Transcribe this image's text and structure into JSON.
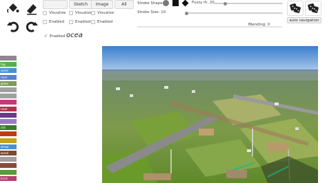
{
  "toolbar": {
    "tabs": [
      {
        "label": "",
        "dim": true
      },
      {
        "label": "Sketch",
        "dim": false
      },
      {
        "label": "Image",
        "dim": false
      },
      {
        "label": "All",
        "dim": false
      }
    ],
    "checkboxes": [
      {
        "label": "Visualize",
        "checked": false
      },
      {
        "label": "Visualize",
        "checked": false
      },
      {
        "label": "Visualize",
        "checked": false
      },
      {
        "label": "Enabled",
        "checked": false
      },
      {
        "label": "Enabled",
        "checked": false
      },
      {
        "label": "Enabled",
        "checked": false
      }
    ],
    "stroke_shape_label": "Stroke Shape",
    "stroke_size_label": "Stroke Size: 10",
    "fuzzy_label": "Fuzzy lh: 20",
    "blending_label": "Blending: 0",
    "auto_navigation_label": "auto navigation",
    "enabled_label": "Enabled",
    "enabled_checked": true
  },
  "prompt": {
    "value": "ocea"
  },
  "sidebar": {
    "labels": [
      {
        "text": "",
        "color": "#8a8a8a"
      },
      {
        "text": "fog",
        "color": "#55b04a"
      },
      {
        "text": "water",
        "color": "#4a8fd8"
      },
      {
        "text": "river",
        "color": "#5a7fcf"
      },
      {
        "text": "grass",
        "color": "#7c9c5c"
      },
      {
        "text": "",
        "color": "#a0a0a0"
      },
      {
        "text": "",
        "color": "#a0a0a0"
      },
      {
        "text": "",
        "color": "#c23a7a"
      },
      {
        "text": "road",
        "color": "#b0324a"
      },
      {
        "text": "",
        "color": "#6a3a8a"
      },
      {
        "text": "",
        "color": "#9a7ac8"
      },
      {
        "text": "dirt",
        "color": "#3a7a2a"
      },
      {
        "text": "",
        "color": "#c03a1a"
      },
      {
        "text": "",
        "color": "#c8a020"
      },
      {
        "text": "straw",
        "color": "#4a8fd8"
      },
      {
        "text": "wood",
        "color": "#7a4a2a"
      },
      {
        "text": "",
        "color": "#a0a0a0"
      },
      {
        "text": "",
        "color": "#8a4a3a"
      },
      {
        "text": "",
        "color": "#5a9a3a"
      },
      {
        "text": "brick",
        "color": "#b04070"
      }
    ]
  }
}
